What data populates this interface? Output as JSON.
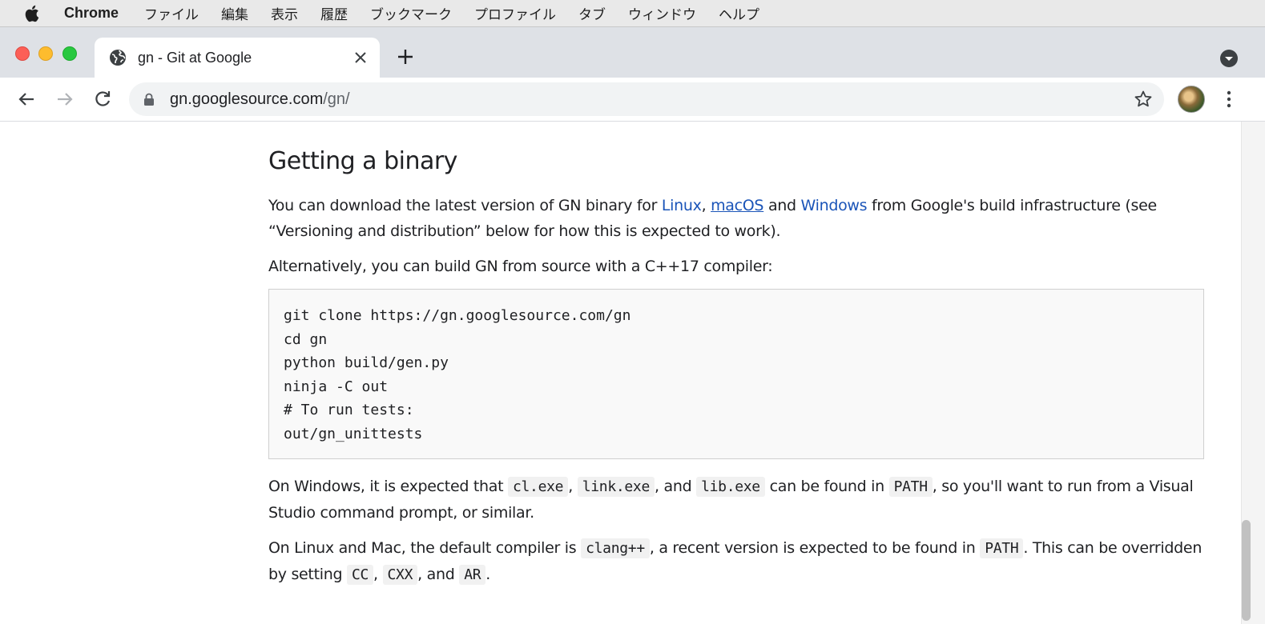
{
  "menubar": {
    "app": "Chrome",
    "items": [
      "ファイル",
      "編集",
      "表示",
      "履歴",
      "ブックマーク",
      "プロファイル",
      "タブ",
      "ウィンドウ",
      "ヘルプ"
    ]
  },
  "tab": {
    "title": "gn - Git at Google"
  },
  "omnibox": {
    "host": "gn.googlesource.com",
    "path": "/gn/"
  },
  "content": {
    "heading": "Getting a binary",
    "p1": {
      "before": "You can download the latest version of GN binary for ",
      "link_linux": "Linux",
      "sep1": ", ",
      "link_macos": "macOS",
      "mid": " and ",
      "link_windows": "Windows",
      "after": " from Google's build infrastructure (see “Versioning and distribution” below for how this is expected to work)."
    },
    "p2": "Alternatively, you can build GN from source with a C++17 compiler:",
    "code_lines": [
      "git clone https://gn.googlesource.com/gn",
      "cd gn",
      "python build/gen.py",
      "ninja -C out",
      "# To run tests:",
      "out/gn_unittests"
    ],
    "p3": {
      "t1": "On Windows, it is expected that ",
      "c1": "cl.exe",
      "t2": ", ",
      "c2": "link.exe",
      "t3": ", and ",
      "c3": "lib.exe",
      "t4": " can be found in ",
      "c4": "PATH",
      "t5": ", so you'll want to run from a Visual Studio command prompt, or similar."
    },
    "p4": {
      "t1": "On Linux and Mac, the default compiler is ",
      "c1": "clang++",
      "t2": ", a recent version is expected to be found in ",
      "c2": "PATH",
      "t3": ". This can be overridden by setting ",
      "c3": "CC",
      "t4": ", ",
      "c4": "CXX",
      "t5": ", and ",
      "c5": "AR",
      "t6": "."
    }
  },
  "colors": {
    "link": "#1a54b8",
    "tabstrip": "#dee1e6",
    "code_bg": "#f9f9f9"
  }
}
